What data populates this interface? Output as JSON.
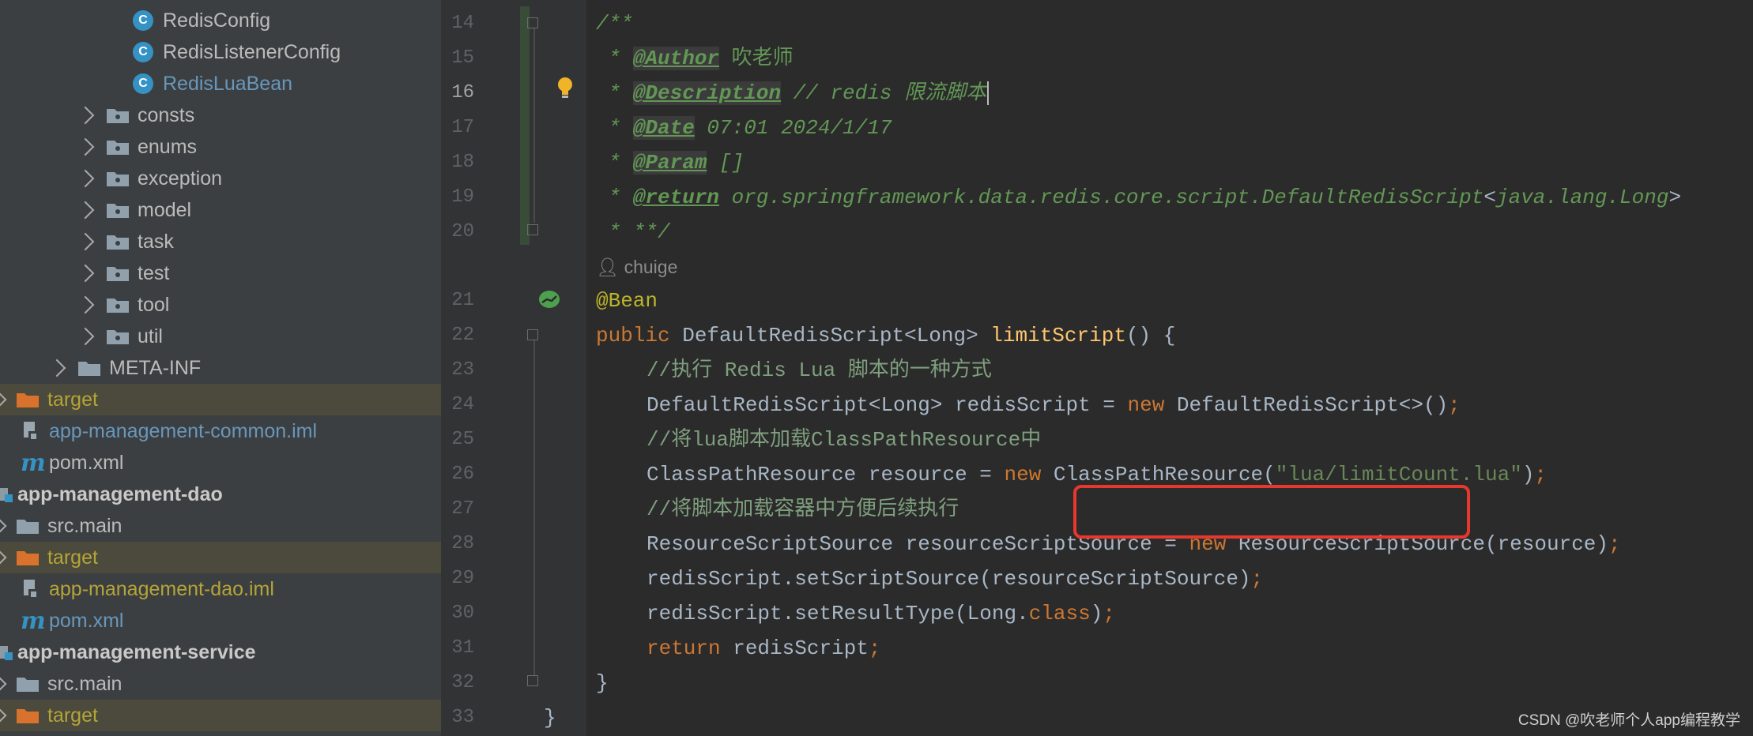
{
  "tree": {
    "items": [
      {
        "label": "RedisConfig",
        "type": "class"
      },
      {
        "label": "RedisListenerConfig",
        "type": "class"
      },
      {
        "label": "RedisLuaBean",
        "type": "class"
      },
      {
        "label": "consts",
        "type": "folder"
      },
      {
        "label": "enums",
        "type": "folder"
      },
      {
        "label": "exception",
        "type": "folder"
      },
      {
        "label": "model",
        "type": "folder"
      },
      {
        "label": "task",
        "type": "folder"
      },
      {
        "label": "test",
        "type": "folder"
      },
      {
        "label": "tool",
        "type": "folder"
      },
      {
        "label": "util",
        "type": "folder"
      },
      {
        "label": "META-INF",
        "type": "folder"
      },
      {
        "label": "target",
        "type": "target"
      },
      {
        "label": "app-management-common.iml",
        "type": "iml"
      },
      {
        "label": "pom.xml",
        "type": "pom"
      },
      {
        "label": "app-management-dao",
        "type": "module"
      },
      {
        "label": "src.main",
        "type": "folder"
      },
      {
        "label": "target",
        "type": "target"
      },
      {
        "label": "app-management-dao.iml",
        "type": "iml"
      },
      {
        "label": "pom.xml",
        "type": "pom"
      },
      {
        "label": "app-management-service",
        "type": "module"
      },
      {
        "label": "src.main",
        "type": "folder"
      },
      {
        "label": "target",
        "type": "target"
      }
    ]
  },
  "editor": {
    "line_numbers": [
      "14",
      "15",
      "16",
      "17",
      "18",
      "19",
      "20",
      "21",
      "22",
      "23",
      "24",
      "25",
      "26",
      "27",
      "28",
      "29",
      "30",
      "31",
      "32",
      "33"
    ],
    "current_line": "16",
    "doc": {
      "open": "/**",
      "author_tag": "@Author",
      "author_val": " 吹老师",
      "desc_tag": "@Description",
      "desc_val": " // redis 限流脚本",
      "date_tag": "@Date",
      "date_val": " 07:01 2024/1/17",
      "param_tag": "@Param",
      "param_val": " []",
      "return_tag": "@return",
      "return_val_a": " org.springframework.data.redis.core.script.DefaultRedisScript",
      "return_val_b": "java.lang.Long",
      "close": "**/",
      "star": " * "
    },
    "author_hint": "chuige",
    "code": {
      "bean": "@Bean",
      "public": "public",
      "ret_type": " DefaultRedisScript<Long> ",
      "method": "limitScript",
      "sig_end": "() {",
      "c1": "//执行 Redis Lua 脚本的一种方式",
      "l24a": "DefaultRedisScript<Long> redisScript = ",
      "new": "new",
      "l24b": " DefaultRedisScript<>()",
      "semi": ";",
      "c2": "//将lua脚本加载ClassPathResource中",
      "l26a": "ClassPathResource resource = ",
      "l26b": " ClassPathResource(",
      "l26str": "\"lua/limitCount.lua\"",
      "l26c": ")",
      "c3": "//将脚本加载容器中方便后续执行",
      "l28a": "ResourceScriptSource resourceScriptSource = ",
      "l28b": " ResourceScriptSource(resource)",
      "l29": "redisScript.setScriptSource(resourceScriptSource)",
      "l30a": "redisScript.setResultType(Long.",
      "class_kw": "class",
      "l30b": ")",
      "return_kw": "return",
      "l31": " redisScript",
      "close_method": "}",
      "close_class": "}"
    }
  },
  "watermark": "CSDN @吹老师个人app编程教学",
  "colors": {
    "highlight_box": "#e8372c",
    "doc_comment": "#629755",
    "keyword": "#cc7832",
    "annotation": "#bbb529",
    "method": "#ffc66d",
    "string": "#6a8759"
  }
}
